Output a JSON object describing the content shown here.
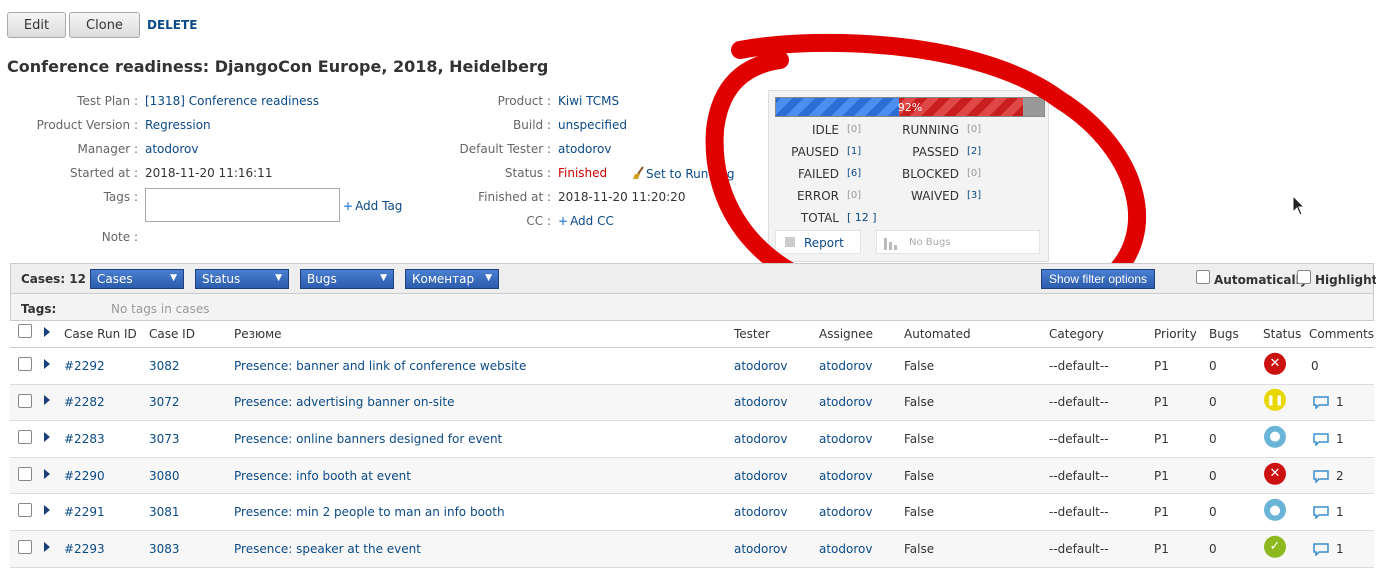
{
  "actions": {
    "edit": "Edit",
    "clone": "Clone",
    "delete": "DELETE"
  },
  "title": "Conference readiness: DjangoCon Europe, 2018, Heidelberg",
  "info": {
    "test_plan_label": "Test Plan :",
    "test_plan": "[1318] Conference readiness",
    "product_version_label": "Product Version :",
    "product_version": "Regression",
    "manager_label": "Manager :",
    "manager": "atodorov",
    "started_label": "Started at :",
    "started": "2018-11-20 11:16:11",
    "tags_label": "Tags :",
    "add_tag": "Add Tag",
    "note_label": "Note :",
    "product_label": "Product :",
    "product": "Kiwi TCMS",
    "build_label": "Build :",
    "build": "unspecified",
    "default_tester_label": "Default Tester :",
    "default_tester": "atodorov",
    "status_label": "Status :",
    "status": "Finished",
    "set_running": "Set to Running",
    "finished_label": "Finished at :",
    "finished": "2018-11-20 11:20:20",
    "cc_label": "CC :",
    "add_cc": "Add CC"
  },
  "stats": {
    "percent": "92%",
    "progress": {
      "passed_fraction": 0.46,
      "failed_fraction": 0.46
    },
    "idle_label": "IDLE",
    "idle": "[0]",
    "running_label": "RUNNING",
    "running": "[0]",
    "paused_label": "PAUSED",
    "paused": "[1]",
    "passed_label": "PASSED",
    "passed": "[2]",
    "failed_label": "FAILED",
    "failed": "[6]",
    "blocked_label": "BLOCKED",
    "blocked": "[0]",
    "error_label": "ERROR",
    "error": "[0]",
    "waived_label": "WAIVED",
    "waived": "[3]",
    "total_label": "TOTAL",
    "total": "[ 12 ]",
    "report": "Report",
    "no_bugs": "No Bugs"
  },
  "toolbar": {
    "cases_count": "Cases: 12",
    "dropdown_cases": "Cases",
    "dropdown_status": "Status",
    "dropdown_bugs": "Bugs",
    "dropdown_comment": "Коментар",
    "show_filter": "Show filter options",
    "automatically": "Automatically",
    "highlight": "Highlight"
  },
  "tags_bar": {
    "label": "Tags:",
    "value": "No tags in cases"
  },
  "table": {
    "headers": {
      "case_run_id": "Case Run ID",
      "case_id": "Case ID",
      "summary": "Резюме",
      "tester": "Tester",
      "assignee": "Assignee",
      "automated": "Automated",
      "category": "Category",
      "priority": "Priority",
      "bugs": "Bugs",
      "status": "Status",
      "comments": "Comments"
    },
    "rows": [
      {
        "run_id": "#2292",
        "case_id": "3082",
        "summary": "Presence: banner and link of conference website",
        "tester": "atodorov",
        "assignee": "atodorov",
        "automated": "False",
        "category": "--default--",
        "priority": "P1",
        "bugs": "0",
        "status": "failed",
        "comments": "0"
      },
      {
        "run_id": "#2282",
        "case_id": "3072",
        "summary": "Presence: advertising banner on-site",
        "tester": "atodorov",
        "assignee": "atodorov",
        "automated": "False",
        "category": "--default--",
        "priority": "P1",
        "bugs": "0",
        "status": "paused",
        "comments": "1"
      },
      {
        "run_id": "#2283",
        "case_id": "3073",
        "summary": "Presence: online banners designed for event",
        "tester": "atodorov",
        "assignee": "atodorov",
        "automated": "False",
        "category": "--default--",
        "priority": "P1",
        "bugs": "0",
        "status": "waived",
        "comments": "1"
      },
      {
        "run_id": "#2290",
        "case_id": "3080",
        "summary": "Presence: info booth at event",
        "tester": "atodorov",
        "assignee": "atodorov",
        "automated": "False",
        "category": "--default--",
        "priority": "P1",
        "bugs": "0",
        "status": "failed",
        "comments": "2"
      },
      {
        "run_id": "#2291",
        "case_id": "3081",
        "summary": "Presence: min 2 people to man an info booth",
        "tester": "atodorov",
        "assignee": "atodorov",
        "automated": "False",
        "category": "--default--",
        "priority": "P1",
        "bugs": "0",
        "status": "waived",
        "comments": "1"
      },
      {
        "run_id": "#2293",
        "case_id": "3083",
        "summary": "Presence: speaker at the event",
        "tester": "atodorov",
        "assignee": "atodorov",
        "automated": "False",
        "category": "--default--",
        "priority": "P1",
        "bugs": "0",
        "status": "passed",
        "comments": "1"
      }
    ]
  },
  "colors": {
    "link": "#0b4a86",
    "finished": "#cc0000",
    "annotation": "#e00000",
    "dropdown": "#2c5cae"
  }
}
